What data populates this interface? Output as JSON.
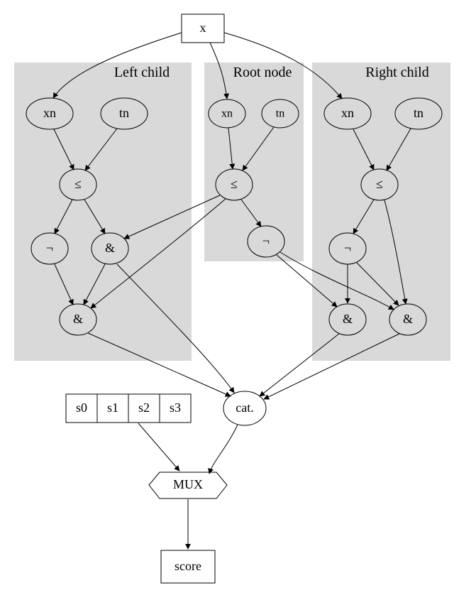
{
  "input": {
    "x": "x"
  },
  "groups": {
    "left": {
      "title": "Left child",
      "xn": "xn",
      "tn": "tn",
      "le": "≤",
      "not": "¬",
      "and": "&",
      "and2": "&"
    },
    "root": {
      "title": "Root node",
      "xn": "xn",
      "tn": "tn",
      "le": "≤",
      "not": "¬"
    },
    "right": {
      "title": "Right child",
      "xn": "xn",
      "tn": "tn",
      "le": "≤",
      "not": "¬",
      "and_l": "&",
      "and_r": "&"
    }
  },
  "scores": {
    "s0": "s0",
    "s1": "s1",
    "s2": "s2",
    "s3": "s3"
  },
  "cat": "cat.",
  "mux": "MUX",
  "score": "score"
}
